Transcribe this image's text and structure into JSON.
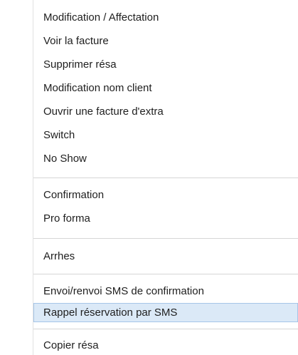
{
  "menu": {
    "items": [
      {
        "label": "Modification / Affectation"
      },
      {
        "label": "Voir la facture"
      },
      {
        "label": "Supprimer résa"
      },
      {
        "label": "Modification nom client"
      },
      {
        "label": "Ouvrir une facture d'extra"
      },
      {
        "label": "Switch"
      },
      {
        "label": "No Show"
      },
      {
        "label": "Confirmation"
      },
      {
        "label": "Pro forma"
      },
      {
        "label": "Arrhes"
      },
      {
        "label": "Envoi/renvoi SMS de confirmation"
      },
      {
        "label": "Rappel réservation par SMS",
        "highlighted": true
      },
      {
        "label": "Copier résa"
      }
    ]
  }
}
